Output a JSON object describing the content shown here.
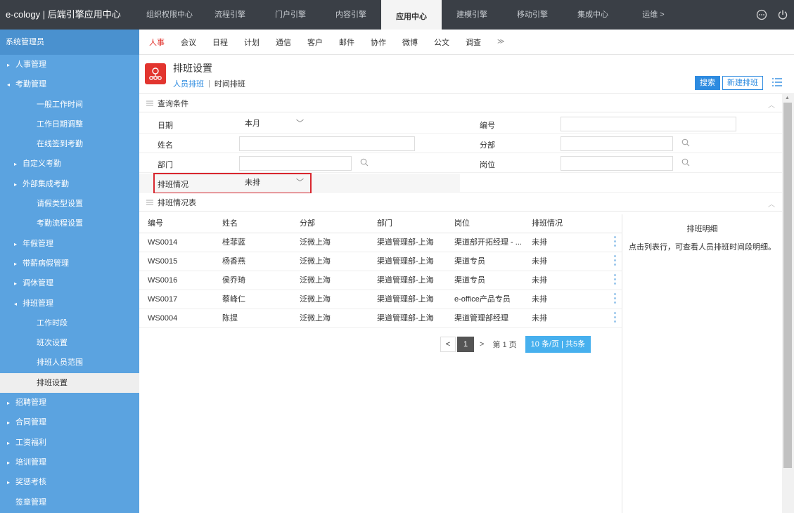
{
  "brand": "e-cology | 后端引擎应用中心",
  "topnav": [
    {
      "label": "组织权限中心"
    },
    {
      "label": "流程引擎"
    },
    {
      "label": "门户引擎"
    },
    {
      "label": "内容引擎"
    },
    {
      "label": "应用中心",
      "active": true
    },
    {
      "label": "建模引擎"
    },
    {
      "label": "移动引擎"
    },
    {
      "label": "集成中心"
    },
    {
      "label": "运维 >"
    }
  ],
  "sidebar": {
    "header": "系统管理员",
    "items": [
      {
        "label": "人事管理",
        "level": 1,
        "arrow": "▸"
      },
      {
        "label": "考勤管理",
        "level": 1,
        "arrow": "◂"
      },
      {
        "label": "一般工作时间",
        "level": 3,
        "arrow": ""
      },
      {
        "label": "工作日期调整",
        "level": 3,
        "arrow": ""
      },
      {
        "label": "在线签到考勤",
        "level": 3,
        "arrow": ""
      },
      {
        "label": "自定义考勤",
        "level": 2,
        "arrow": "▸"
      },
      {
        "label": "外部集成考勤",
        "level": 2,
        "arrow": "▸"
      },
      {
        "label": "请假类型设置",
        "level": 3,
        "arrow": ""
      },
      {
        "label": "考勤流程设置",
        "level": 3,
        "arrow": ""
      },
      {
        "label": "年假管理",
        "level": 2,
        "arrow": "▸"
      },
      {
        "label": "带薪病假管理",
        "level": 2,
        "arrow": "▸"
      },
      {
        "label": "调休管理",
        "level": 2,
        "arrow": "▸"
      },
      {
        "label": "排班管理",
        "level": 2,
        "arrow": "◂"
      },
      {
        "label": "工作时段",
        "level": 3,
        "arrow": ""
      },
      {
        "label": "班次设置",
        "level": 3,
        "arrow": ""
      },
      {
        "label": "排班人员范围",
        "level": 3,
        "arrow": ""
      },
      {
        "label": "排班设置",
        "level": 3,
        "arrow": "",
        "active": true
      },
      {
        "label": "招聘管理",
        "level": 1,
        "arrow": "▸"
      },
      {
        "label": "合同管理",
        "level": 1,
        "arrow": "▸"
      },
      {
        "label": "工资福利",
        "level": 1,
        "arrow": "▸"
      },
      {
        "label": "培训管理",
        "level": 1,
        "arrow": "▸"
      },
      {
        "label": "奖惩考核",
        "level": 1,
        "arrow": "▸"
      },
      {
        "label": "签章管理",
        "level": 1,
        "arrow": ""
      }
    ]
  },
  "subnav": {
    "tabs": [
      {
        "label": "人事",
        "active": true
      },
      {
        "label": "会议"
      },
      {
        "label": "日程"
      },
      {
        "label": "计划"
      },
      {
        "label": "通信"
      },
      {
        "label": "客户"
      },
      {
        "label": "邮件"
      },
      {
        "label": "协作"
      },
      {
        "label": "微博"
      },
      {
        "label": "公文"
      },
      {
        "label": "调查"
      }
    ],
    "more": "≫"
  },
  "page": {
    "title": "排班设置",
    "tab_active": "人员排班",
    "tab_sep": "|",
    "tab_other": "时间排班",
    "search_label": "搜索",
    "new_label": "新建排班"
  },
  "query": {
    "section_title": "查询条件",
    "date_label": "日期",
    "date_value": "本月",
    "number_label": "编号",
    "name_label": "姓名",
    "branch_label": "分部",
    "dept_label": "部门",
    "post_label": "岗位",
    "status_label": "排班情况",
    "status_value": "未排"
  },
  "table": {
    "section_title": "排班情况表",
    "columns": [
      "编号",
      "姓名",
      "分部",
      "部门",
      "岗位",
      "排班情况"
    ],
    "rows": [
      [
        "WS0014",
        "桂菲蓝",
        "泛微上海",
        "渠道管理部-上海",
        "渠道部开拓经理 - ...",
        "未排"
      ],
      [
        "WS0015",
        "杨香燕",
        "泛微上海",
        "渠道管理部-上海",
        "渠道专员",
        "未排"
      ],
      [
        "WS0016",
        "侯乔琦",
        "泛微上海",
        "渠道管理部-上海",
        "渠道专员",
        "未排"
      ],
      [
        "WS0017",
        "蔡峰仁",
        "泛微上海",
        "渠道管理部-上海",
        "e-office产品专员",
        "未排"
      ],
      [
        "WS0004",
        "陈提",
        "泛微上海",
        "渠道管理部-上海",
        "渠道管理部经理",
        "未排"
      ]
    ]
  },
  "pager": {
    "prev": "<",
    "current": "1",
    "next": ">",
    "page_text": "第  1  页",
    "size_text": "10  条/页 | 共5条"
  },
  "detail": {
    "title": "排班明细",
    "hint": "点击列表行，可查看人员排班时间段明细。"
  }
}
